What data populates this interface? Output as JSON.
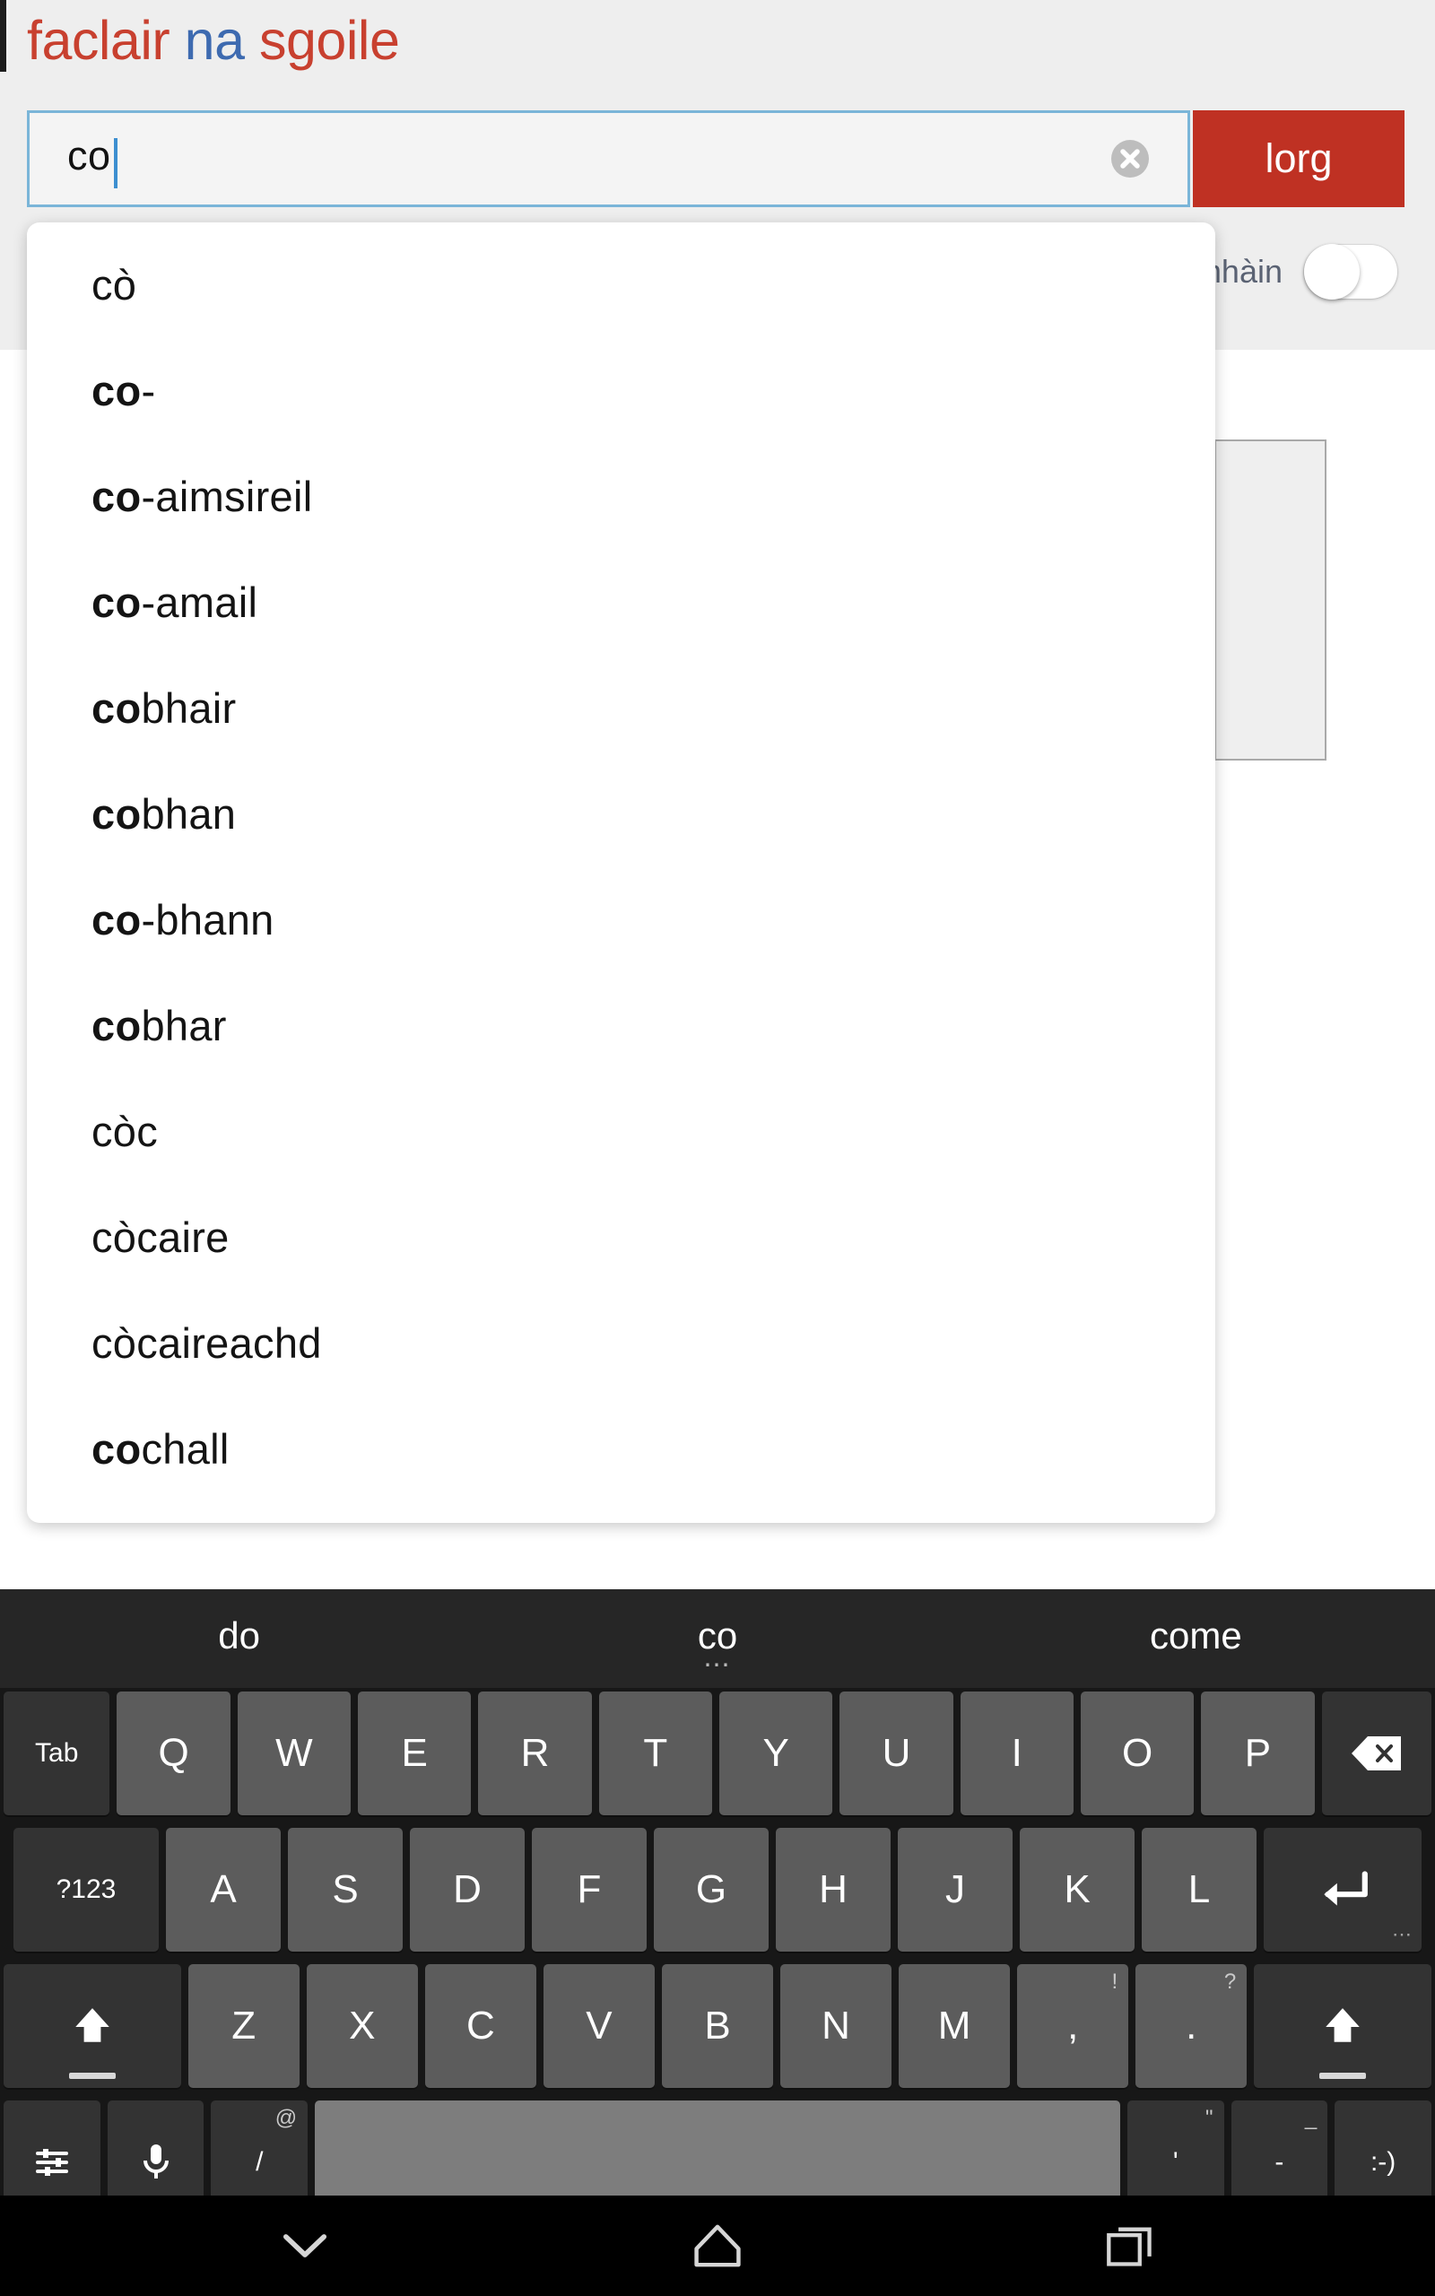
{
  "app": {
    "title_part1": "faclair",
    "title_part2": "na",
    "title_part3": "sgoile",
    "brand_red": "#c8402f",
    "brand_blue": "#3d6ab0",
    "button_red": "#bf3123"
  },
  "search": {
    "value": "co",
    "placeholder": "",
    "clear_icon": "clear-circle-icon",
    "button_label": "lorg"
  },
  "options": {
    "toggle_label": "mhàin",
    "toggle_state": "off"
  },
  "autocomplete": {
    "prefix": "co",
    "items": [
      {
        "bold": "",
        "rest": "cò"
      },
      {
        "bold": "co",
        "rest": "-"
      },
      {
        "bold": "co",
        "rest": "-aimsireil"
      },
      {
        "bold": "co",
        "rest": "-amail"
      },
      {
        "bold": "co",
        "rest": "bhair"
      },
      {
        "bold": "co",
        "rest": "bhan"
      },
      {
        "bold": "co",
        "rest": "-bhann"
      },
      {
        "bold": "co",
        "rest": "bhar"
      },
      {
        "bold": "",
        "rest": "còc"
      },
      {
        "bold": "",
        "rest": "còcaire"
      },
      {
        "bold": "",
        "rest": "còcaireachd"
      },
      {
        "bold": "co",
        "rest": "chall"
      }
    ]
  },
  "keyboard": {
    "suggestions": [
      {
        "label": "do",
        "dots": ""
      },
      {
        "label": "co",
        "dots": "⋯"
      },
      {
        "label": "come",
        "dots": ""
      }
    ],
    "row1": [
      {
        "label": "Tab",
        "type": "dark",
        "width": "w-tab"
      },
      {
        "label": "Q",
        "type": "mid",
        "width": "w-key"
      },
      {
        "label": "W",
        "type": "mid",
        "width": "w-key"
      },
      {
        "label": "E",
        "type": "mid",
        "width": "w-key"
      },
      {
        "label": "R",
        "type": "mid",
        "width": "w-key"
      },
      {
        "label": "T",
        "type": "mid",
        "width": "w-key"
      },
      {
        "label": "Y",
        "type": "mid",
        "width": "w-key"
      },
      {
        "label": "U",
        "type": "mid",
        "width": "w-key"
      },
      {
        "label": "I",
        "type": "mid",
        "width": "w-key"
      },
      {
        "label": "O",
        "type": "mid",
        "width": "w-key"
      },
      {
        "label": "P",
        "type": "mid",
        "width": "w-key"
      },
      {
        "label": "backspace-icon",
        "type": "dark",
        "width": "w-bksp"
      }
    ],
    "row2": [
      {
        "label": "?123",
        "type": "dark",
        "width": "w-num"
      },
      {
        "label": "A",
        "type": "mid",
        "width": "w-key"
      },
      {
        "label": "S",
        "type": "mid",
        "width": "w-key"
      },
      {
        "label": "D",
        "type": "mid",
        "width": "w-key"
      },
      {
        "label": "F",
        "type": "mid",
        "width": "w-key"
      },
      {
        "label": "G",
        "type": "mid",
        "width": "w-key"
      },
      {
        "label": "H",
        "type": "mid",
        "width": "w-key"
      },
      {
        "label": "J",
        "type": "mid",
        "width": "w-key"
      },
      {
        "label": "K",
        "type": "mid",
        "width": "w-key"
      },
      {
        "label": "L",
        "type": "mid",
        "width": "w-key"
      },
      {
        "label": "enter-icon",
        "type": "dark",
        "width": "w-ent"
      }
    ],
    "row3": [
      {
        "label": "shift-icon",
        "type": "dark",
        "width": "w-shift"
      },
      {
        "label": "Z",
        "type": "mid",
        "width": "w-zrow"
      },
      {
        "label": "X",
        "type": "mid",
        "width": "w-zrow"
      },
      {
        "label": "C",
        "type": "mid",
        "width": "w-zrow"
      },
      {
        "label": "V",
        "type": "mid",
        "width": "w-zrow"
      },
      {
        "label": "B",
        "type": "mid",
        "width": "w-zrow"
      },
      {
        "label": "N",
        "type": "mid",
        "width": "w-zrow"
      },
      {
        "label": "M",
        "type": "mid",
        "width": "w-zrow"
      },
      {
        "label": ",",
        "sub": "!",
        "type": "mid",
        "width": "w-zrow"
      },
      {
        "label": ".",
        "sub": "?",
        "type": "mid",
        "width": "w-zrow"
      },
      {
        "label": "shift-icon",
        "type": "dark",
        "width": "w-shift"
      }
    ],
    "row4": [
      {
        "label": "settings-sliders-icon",
        "type": "dark",
        "width": "w-util"
      },
      {
        "label": "microphone-icon",
        "type": "dark",
        "width": "w-util"
      },
      {
        "label": "/",
        "sub": "@",
        "type": "dark",
        "width": "w-util"
      },
      {
        "label": "",
        "type": "space",
        "width": "w-space"
      },
      {
        "label": "'",
        "sub": "\"",
        "type": "dark",
        "width": "w-util"
      },
      {
        "label": "-",
        "sub": "_",
        "type": "dark",
        "width": "w-util"
      },
      {
        "label": ":-)",
        "type": "dark",
        "width": "w-util"
      }
    ]
  },
  "navbar": {
    "back_icon": "chevron-down-icon",
    "home_icon": "home-icon",
    "recents_icon": "recent-apps-icon"
  }
}
